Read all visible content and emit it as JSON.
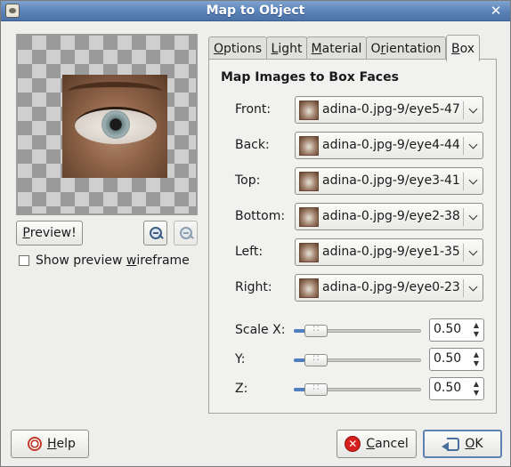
{
  "window": {
    "title": "Map to Object",
    "close_glyph": "✕"
  },
  "preview": {
    "preview_button": {
      "label": "Preview!",
      "mnemonic": "P",
      "rest": "review!"
    },
    "zoom_out_icon": "zoom-out-icon",
    "zoom_in_icon": "zoom-in-icon",
    "wireframe_checkbox": {
      "prefix": "Show preview ",
      "mnemonic": "w",
      "rest": "ireframe",
      "label": "Show preview wireframe",
      "checked": false
    }
  },
  "tabs": [
    {
      "label": "Options",
      "mnemonic": "O",
      "rest": "ptions",
      "active": false
    },
    {
      "label": "Light",
      "mnemonic": "L",
      "rest": "ight",
      "active": false
    },
    {
      "label": "Material",
      "mnemonic": "M",
      "rest": "aterial",
      "active": false
    },
    {
      "label": "Orientation",
      "prefix": "O",
      "mnemonic": "r",
      "rest": "ientation",
      "active": false
    },
    {
      "label": "Box",
      "mnemonic": "B",
      "rest": "ox",
      "active": true
    }
  ],
  "box": {
    "section_title": "Map Images to Box Faces",
    "faces": [
      {
        "label": "Front:",
        "value": "adina-0.jpg-9/eye5-47"
      },
      {
        "label": "Back:",
        "value": "adina-0.jpg-9/eye4-44"
      },
      {
        "label": "Top:",
        "value": "adina-0.jpg-9/eye3-41"
      },
      {
        "label": "Bottom:",
        "value": "adina-0.jpg-9/eye2-38"
      },
      {
        "label": "Left:",
        "value": "adina-0.jpg-9/eye1-35"
      },
      {
        "label": "Right:",
        "value": "adina-0.jpg-9/eye0-23"
      }
    ],
    "scales": [
      {
        "label": "Scale X:",
        "value": "0.50",
        "fraction": 0.1
      },
      {
        "label": "Y:",
        "value": "0.50",
        "fraction": 0.1
      },
      {
        "label": "Z:",
        "value": "0.50",
        "fraction": 0.1
      }
    ]
  },
  "buttons": {
    "help": {
      "label": "Help",
      "mnemonic": "H",
      "rest": "elp"
    },
    "cancel": {
      "label": "Cancel",
      "mnemonic": "C",
      "rest": "ancel"
    },
    "ok": {
      "label": "OK",
      "mnemonic": "O",
      "rest": "K"
    }
  },
  "colors": {
    "titlebar": "#5a82b8",
    "accent": "#4f7fbf",
    "cancel": "#d5201b"
  }
}
